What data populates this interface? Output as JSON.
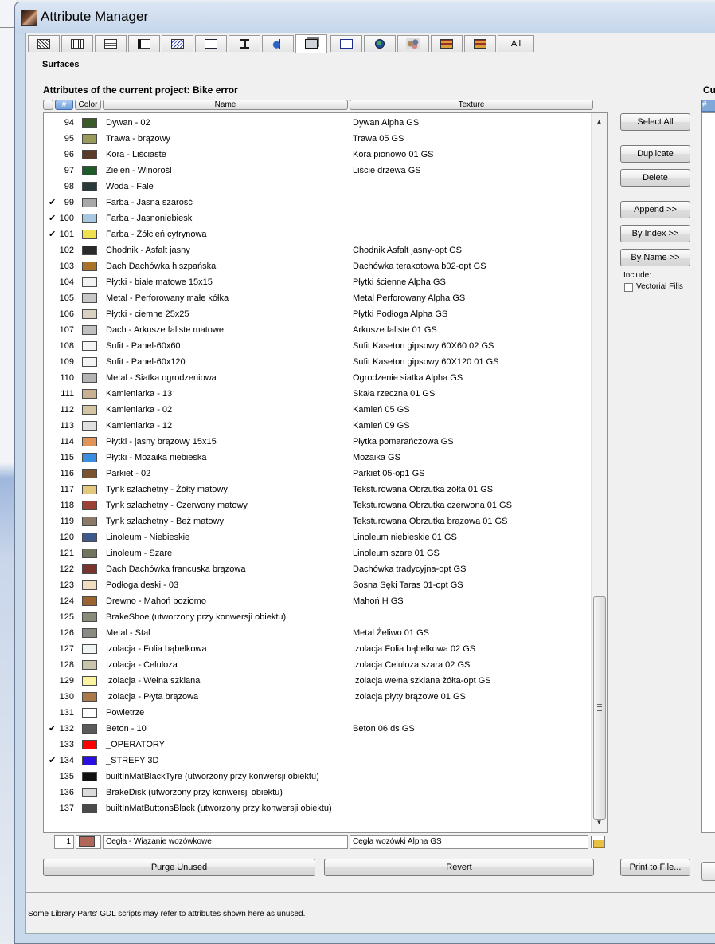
{
  "window": {
    "title": "Attribute Manager"
  },
  "tabs": [
    {
      "icon": "layers-icon",
      "label": ""
    },
    {
      "icon": "line-types-icon",
      "label": ""
    },
    {
      "icon": "fill-types-icon",
      "label": ""
    },
    {
      "icon": "pens-icon",
      "label": ""
    },
    {
      "icon": "composites-icon",
      "label": ""
    },
    {
      "icon": "profiles-icon",
      "label": ""
    },
    {
      "icon": "zones-icon",
      "label": ""
    },
    {
      "icon": "building-materials-icon",
      "label": ""
    },
    {
      "icon": "surfaces-icon",
      "label": ""
    },
    {
      "icon": "mep-systems-icon",
      "label": ""
    },
    {
      "icon": "markup-styles-icon",
      "label": ""
    },
    {
      "icon": "globe-icon",
      "label": ""
    },
    {
      "icon": "operation-profiles-icon",
      "label": ""
    },
    {
      "icon": "renovation-icon",
      "label": ""
    },
    {
      "icon": "",
      "label": "All"
    }
  ],
  "section_label": "Surfaces",
  "project_title": "Attributes of the current project: Bike error",
  "right_panel_title_cut": "Cur",
  "right_panel_badge": "#",
  "columns": {
    "hash": "#",
    "color": "Color",
    "name": "Name",
    "texture": "Texture"
  },
  "rows": [
    {
      "check": "",
      "idx": "94",
      "color": "#3b5a2a",
      "name": "Dywan - 02",
      "texture": "Dywan Alpha GS"
    },
    {
      "check": "",
      "idx": "95",
      "color": "#9a9a5a",
      "name": "Trawa - brązowy",
      "texture": "Trawa 05 GS"
    },
    {
      "check": "",
      "idx": "96",
      "color": "#5a3a2a",
      "name": "Kora - Liściaste",
      "texture": "Kora pionowo 01 GS"
    },
    {
      "check": "",
      "idx": "97",
      "color": "#1f5a2a",
      "name": "Zieleń - Winorośl",
      "texture": "Liście drzewa GS"
    },
    {
      "check": "",
      "idx": "98",
      "color": "#2a3a3a",
      "name": "Woda - Fale",
      "texture": ""
    },
    {
      "check": "✔",
      "idx": "99",
      "color": "#a8a8a8",
      "name": "Farba - Jasna szarość",
      "texture": ""
    },
    {
      "check": "✔",
      "idx": "100",
      "color": "#a8c8e0",
      "name": "Farba - Jasnoniebieski",
      "texture": ""
    },
    {
      "check": "✔",
      "idx": "101",
      "color": "#f0e050",
      "name": "Farba - Żółcień cytrynowa",
      "texture": ""
    },
    {
      "check": "",
      "idx": "102",
      "color": "#2a2a2a",
      "name": "Chodnik - Asfalt jasny",
      "texture": "Chodnik Asfalt jasny-opt GS"
    },
    {
      "check": "",
      "idx": "103",
      "color": "#a8742a",
      "name": "Dach Dachówka hiszpańska",
      "texture": "Dachówka terakotowa b02-opt GS"
    },
    {
      "check": "",
      "idx": "104",
      "color": "#f2f2f2",
      "name": "Płytki - białe matowe 15x15",
      "texture": "Płytki ścienne Alpha GS"
    },
    {
      "check": "",
      "idx": "105",
      "color": "#c8c8c8",
      "name": "Metal - Perforowany małe kółka",
      "texture": "Metal Perforowany Alpha GS"
    },
    {
      "check": "",
      "idx": "106",
      "color": "#d8d0c0",
      "name": "Płytki - ciemne 25x25",
      "texture": "Płytki Podłoga Alpha GS"
    },
    {
      "check": "",
      "idx": "107",
      "color": "#c0c0c0",
      "name": "Dach - Arkusze faliste matowe",
      "texture": "Arkusze faliste 01 GS"
    },
    {
      "check": "",
      "idx": "108",
      "color": "#f4f4f4",
      "name": "Sufit - Panel-60x60",
      "texture": "Sufit Kaseton gipsowy 60X60 02 GS"
    },
    {
      "check": "",
      "idx": "109",
      "color": "#f4f4f4",
      "name": "Sufit - Panel-60x120",
      "texture": "Sufit Kaseton gipsowy 60X120 01 GS"
    },
    {
      "check": "",
      "idx": "110",
      "color": "#b4b4b4",
      "name": "Metal - Siatka ogrodzeniowa",
      "texture": "Ogrodzenie siatka Alpha GS"
    },
    {
      "check": "",
      "idx": "111",
      "color": "#c8b090",
      "name": "Kamieniarka - 13",
      "texture": "Skała rzeczna 01 GS"
    },
    {
      "check": "",
      "idx": "112",
      "color": "#d4c4a4",
      "name": "Kamieniarka - 02",
      "texture": "Kamień 05 GS"
    },
    {
      "check": "",
      "idx": "113",
      "color": "#e0e0e0",
      "name": "Kamieniarka - 12",
      "texture": "Kamień 09 GS"
    },
    {
      "check": "",
      "idx": "114",
      "color": "#e0945a",
      "name": "Płytki - jasny brązowy 15x15",
      "texture": "Płytka pomarańczowa GS"
    },
    {
      "check": "",
      "idx": "115",
      "color": "#3a8ee0",
      "name": "Płytki - Mozaika niebieska",
      "texture": "Mozaika GS"
    },
    {
      "check": "",
      "idx": "116",
      "color": "#7a5430",
      "name": "Parkiet - 02",
      "texture": "Parkiet 05-op1 GS"
    },
    {
      "check": "",
      "idx": "117",
      "color": "#e4c880",
      "name": "Tynk szlachetny - Żółty matowy",
      "texture": "Teksturowana Obrzutka żółta 01 GS"
    },
    {
      "check": "",
      "idx": "118",
      "color": "#9a4234",
      "name": "Tynk szlachetny - Czerwony matowy",
      "texture": "Teksturowana Obrzutka czerwona 01 GS"
    },
    {
      "check": "",
      "idx": "119",
      "color": "#8a7a68",
      "name": "Tynk szlachetny - Beż matowy",
      "texture": "Teksturowana Obrzutka brązowa 01 GS"
    },
    {
      "check": "",
      "idx": "120",
      "color": "#3e5a8a",
      "name": "Linoleum - Niebieskie",
      "texture": "Linoleum niebieskie 01 GS"
    },
    {
      "check": "",
      "idx": "121",
      "color": "#727462",
      "name": "Linoleum - Szare",
      "texture": "Linoleum szare 01 GS"
    },
    {
      "check": "",
      "idx": "122",
      "color": "#7a3430",
      "name": "Dach Dachówka francuska brązowa",
      "texture": "Dachówka tradycyjna-opt GS"
    },
    {
      "check": "",
      "idx": "123",
      "color": "#f0dcc0",
      "name": "Podłoga deski - 03",
      "texture": "Sosna Sęki Taras 01-opt GS"
    },
    {
      "check": "",
      "idx": "124",
      "color": "#9a6430",
      "name": "Drewno - Mahoń poziomo",
      "texture": "Mahoń H GS"
    },
    {
      "check": "",
      "idx": "125",
      "color": "#8a8a7a",
      "name": "BrakeShoe (utworzony przy konwersji obiektu)",
      "texture": ""
    },
    {
      "check": "",
      "idx": "126",
      "color": "#8a8a80",
      "name": "Metal - Stal",
      "texture": "Metal Żeliwo 01 GS"
    },
    {
      "check": "",
      "idx": "127",
      "color": "#f0f4f4",
      "name": "Izolacja - Folia bąbelkowa",
      "texture": "Izolacja Folia bąbelkowa 02 GS"
    },
    {
      "check": "",
      "idx": "128",
      "color": "#cac4ac",
      "name": "Izolacja - Celuloza",
      "texture": "Izolacja Celuloza szara 02 GS"
    },
    {
      "check": "",
      "idx": "129",
      "color": "#f8f4a0",
      "name": "Izolacja - Wełna szklana",
      "texture": "Izolacja wełna szklana żółta-opt GS"
    },
    {
      "check": "",
      "idx": "130",
      "color": "#a87a4a",
      "name": "Izolacja - Płyta brązowa",
      "texture": "Izolacja płyty brązowe 01 GS"
    },
    {
      "check": "",
      "idx": "131",
      "color": "#ffffff",
      "name": "Powietrze",
      "texture": ""
    },
    {
      "check": "✔",
      "idx": "132",
      "color": "#5a5a5a",
      "name": "Beton - 10",
      "texture": "Beton 06 ds GS"
    },
    {
      "check": "",
      "idx": "133",
      "color": "#ff0000",
      "name": "_OPERATORY",
      "texture": ""
    },
    {
      "check": "✔",
      "idx": "134",
      "color": "#2a10e0",
      "name": "_STREFY 3D",
      "texture": ""
    },
    {
      "check": "",
      "idx": "135",
      "color": "#101010",
      "name": "builtInMatBlackTyre (utworzony przy konwersji obiektu)",
      "texture": ""
    },
    {
      "check": "",
      "idx": "136",
      "color": "#dcdcdc",
      "name": "BrakeDisk (utworzony przy konwersji obiektu)",
      "texture": ""
    },
    {
      "check": "",
      "idx": "137",
      "color": "#4a4a4a",
      "name": "builtInMatButtonsBlack (utworzony przy konwersji obiektu)",
      "texture": ""
    }
  ],
  "buttons": {
    "select_all": "Select All",
    "duplicate": "Duplicate",
    "delete": "Delete",
    "append": "Append >>",
    "by_index": "By Index >>",
    "by_name": "By Name >>",
    "purge": "Purge Unused",
    "revert": "Revert",
    "print": "Print to File..."
  },
  "include_label": "Include:",
  "vectorial_fills_label": "Vectorial Fills",
  "edit_row": {
    "index": "1",
    "color": "#b0675a",
    "name": "Cegła - Wiązanie wozówkowe",
    "texture": "Cegła wozówki Alpha GS"
  },
  "footer_text": "Some Library Parts' GDL scripts may refer to attributes shown here as unused."
}
